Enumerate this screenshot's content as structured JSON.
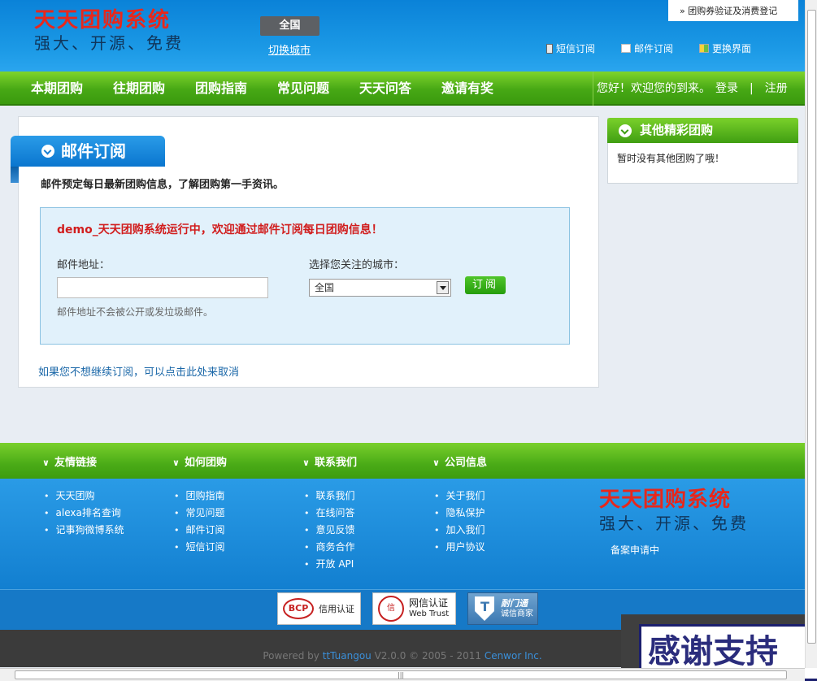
{
  "header": {
    "logo_title": "天天团购系统",
    "logo_sub": "强大、开源、免费",
    "city": "全国",
    "switch_city": "切换城市",
    "top_right": "» 团购券验证及消费登记",
    "links": {
      "sms": "短信订阅",
      "email": "邮件订阅",
      "skin": "更换界面"
    }
  },
  "nav": {
    "items": [
      "本期团购",
      "往期团购",
      "团购指南",
      "常见问题",
      "天天问答",
      "邀请有奖"
    ],
    "welcome": "您好！欢迎您的到来。",
    "login": "登录",
    "separator": "|",
    "register": "注册"
  },
  "main": {
    "tab_title": "邮件订阅",
    "description": "邮件预定每日最新团购信息，了解团购第一手资讯。",
    "demo_text": "demo_天天团购系统运行中，欢迎通过邮件订阅每日团购信息！",
    "email_label": "邮件地址：",
    "email_value": "",
    "city_label": "选择您关注的城市：",
    "city_selected": "全国",
    "subscribe_button": "订阅",
    "hint": "邮件地址不会被公开或发垃圾邮件。",
    "cancel_link": "如果您不想继续订阅，可以点击此处来取消"
  },
  "side": {
    "title": "其他精彩团购",
    "empty_text": "暂时没有其他团购了哦！"
  },
  "footer": {
    "columns": [
      {
        "title": "友情链接",
        "items": [
          "天天团购",
          "alexa排名查询",
          "记事狗微博系统"
        ]
      },
      {
        "title": "如何团购",
        "items": [
          "团购指南",
          "常见问题",
          "邮件订阅",
          "短信订阅"
        ]
      },
      {
        "title": "联系我们",
        "items": [
          "联系我们",
          "在线问答",
          "意见反馈",
          "商务合作",
          "开放 API"
        ]
      },
      {
        "title": "公司信息",
        "items": [
          "关于我们",
          "隐私保护",
          "加入我们",
          "用户协议"
        ]
      }
    ],
    "logo_title": "天天团购系统",
    "logo_sub": "强大、开源、免费",
    "icp": "备案申请中",
    "badges": {
      "bcp_logo": "BCP",
      "bcp_text": "信用认证",
      "trust_logo": "信",
      "trust_cn": "网信认证",
      "trust_en": "Web Trust",
      "ttk_title": "耐门通",
      "ttk_sub": "诚信商家"
    },
    "powered_prefix": "Powered by ",
    "powered_brand": "ttTuangou",
    "powered_mid": " V2.0.0 © 2005 - 2011 ",
    "powered_company": "Cenwor Inc."
  },
  "overlay": {
    "thanks_text": "感谢支持"
  }
}
